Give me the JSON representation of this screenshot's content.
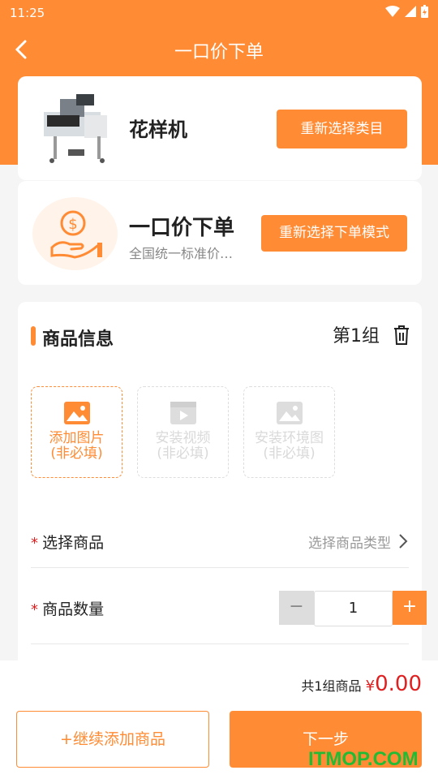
{
  "status": {
    "time": "11:25"
  },
  "nav": {
    "title": "一口价下单"
  },
  "category": {
    "name": "花样机",
    "reselect_label": "重新选择类目"
  },
  "mode": {
    "title": "一口价下单",
    "subtitle": "全国统一标准价…",
    "reselect_label": "重新选择下单模式"
  },
  "section": {
    "title": "商品信息",
    "group_label": "第1组"
  },
  "uploads": [
    {
      "line1": "添加图片",
      "line2": "(非必填)"
    },
    {
      "line1": "安装视频",
      "line2": "(非必填)"
    },
    {
      "line1": "安装环境图",
      "line2": "(非必填)"
    }
  ],
  "form": {
    "required_mark": "*",
    "select_label": "选择商品",
    "select_placeholder": "选择商品类型",
    "qty_label": "商品数量",
    "qty_value": "1",
    "minus": "−",
    "plus": "+"
  },
  "footer": {
    "count_text": "共1组商品",
    "currency": "¥",
    "amount": "0.00",
    "add_label": "+继续添加商品",
    "next_label": "下一步"
  },
  "watermark": "ITMOP.COM",
  "colors": {
    "accent": "#ff8c35",
    "price": "#e02020"
  }
}
